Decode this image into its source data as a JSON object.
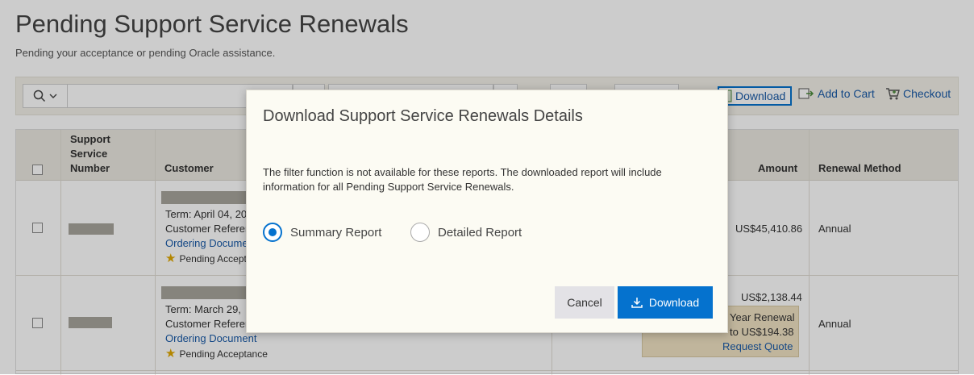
{
  "page": {
    "title": "Pending Support Service Renewals",
    "subtitle": "Pending your acceptance or pending Oracle assistance."
  },
  "toolbar": {
    "download_label": "Download",
    "add_to_cart_label": "Add to Cart",
    "checkout_label": "Checkout"
  },
  "table": {
    "headers": {
      "support_service_number": "Support Service Number",
      "customer": "Customer",
      "amount": "Amount",
      "renewal_method": "Renewal Method"
    },
    "rows": [
      {
        "term": "Term: April 04, 20",
        "customer_reference": "Customer Referen",
        "ordering_document": "Ordering Documen",
        "status": "Pending Acceptan",
        "amount": "US$45,410.86",
        "renewal_method": "Annual"
      },
      {
        "term": "Term: March 29, ",
        "customer_reference": "Customer Referen",
        "ordering_document": "Ordering Document",
        "status": "Pending Acceptance",
        "amount": "US$2,138.44",
        "promo_line1": "Year Renewal",
        "promo_line2": "to US$194.38",
        "promo_link": "Request Quote",
        "renewal_method": "Annual"
      }
    ]
  },
  "dialog": {
    "title": "Download Support Service Renewals Details",
    "message": "The filter function is not available for these reports. The downloaded report will include information for all Pending Support Service Renewals.",
    "options": [
      {
        "label": "Summary Report",
        "selected": true
      },
      {
        "label": "Detailed Report",
        "selected": false
      }
    ],
    "cancel_label": "Cancel",
    "download_label": "Download"
  },
  "colors": {
    "accent": "#0572ce",
    "link": "#1a5ba8"
  }
}
